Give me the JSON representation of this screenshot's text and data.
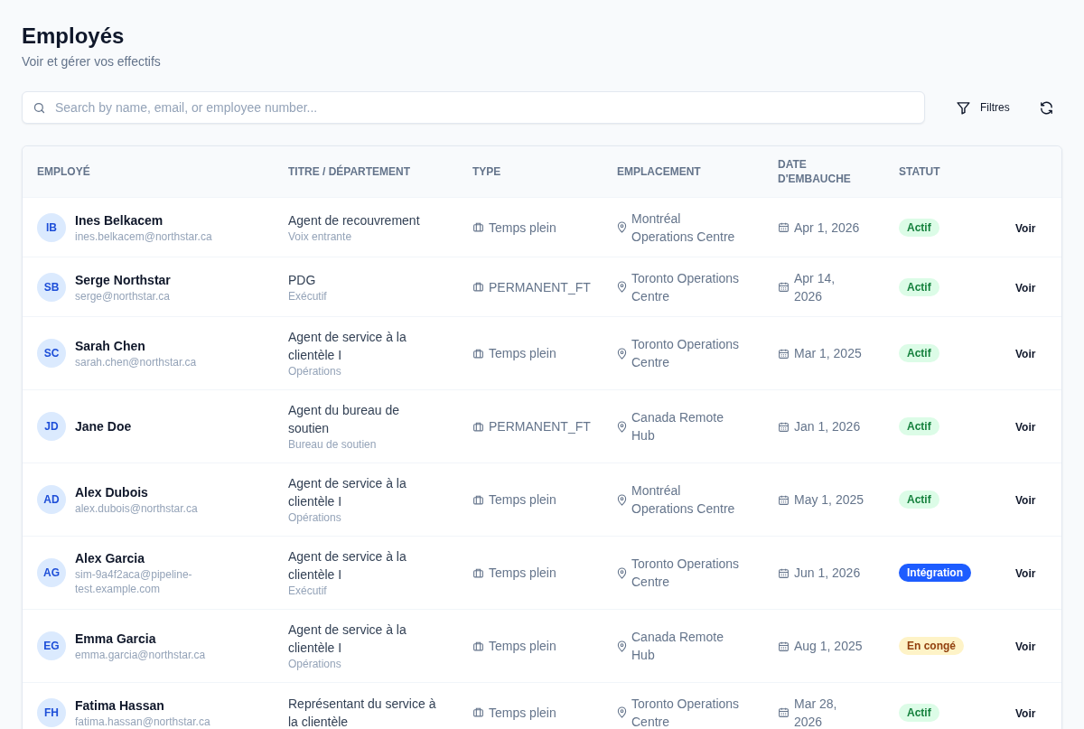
{
  "page": {
    "title": "Employés",
    "subtitle": "Voir et gérer vos effectifs"
  },
  "toolbar": {
    "search_placeholder": "Search by name, email, or employee number...",
    "filter_label": "Filtres"
  },
  "table": {
    "columns": [
      "EMPLOYÉ",
      "TITRE / DÉPARTEMENT",
      "TYPE",
      "EMPLACEMENT",
      "DATE D'EMBAUCHE",
      "STATUT"
    ],
    "rows": [
      {
        "initials": "IB",
        "name": "Ines Belkacem",
        "email": "ines.belkacem@northstar.ca",
        "title": "Agent de recouvrement",
        "department": "Voix entrante",
        "type": "Temps plein",
        "location": "Montréal Operations Centre",
        "hire_date": "Apr 1, 2026",
        "status": {
          "label": "Actif",
          "kind": "active"
        },
        "action": "Voir"
      },
      {
        "initials": "SB",
        "name": "Serge Northstar",
        "email": "serge@northstar.ca",
        "title": "PDG",
        "department": "Exécutif",
        "type": "PERMANENT_FT",
        "location": "Toronto Operations Centre",
        "hire_date": "Apr 14, 2026",
        "status": {
          "label": "Actif",
          "kind": "active"
        },
        "action": "Voir"
      },
      {
        "initials": "SC",
        "name": "Sarah Chen",
        "email": "sarah.chen@northstar.ca",
        "title": "Agent de service à la clientèle I",
        "department": "Opérations",
        "type": "Temps plein",
        "location": "Toronto Operations Centre",
        "hire_date": "Mar 1, 2025",
        "status": {
          "label": "Actif",
          "kind": "active"
        },
        "action": "Voir"
      },
      {
        "initials": "JD",
        "name": "Jane Doe",
        "title": "Agent du bureau de soutien",
        "department": "Bureau de soutien",
        "type": "PERMANENT_FT",
        "location": "Canada Remote Hub",
        "hire_date": "Jan 1, 2026",
        "status": {
          "label": "Actif",
          "kind": "active"
        },
        "action": "Voir"
      },
      {
        "initials": "AD",
        "name": "Alex Dubois",
        "email": "alex.dubois@northstar.ca",
        "title": "Agent de service à la clientèle I",
        "department": "Opérations",
        "type": "Temps plein",
        "location": "Montréal Operations Centre",
        "hire_date": "May 1, 2025",
        "status": {
          "label": "Actif",
          "kind": "active"
        },
        "action": "Voir"
      },
      {
        "initials": "AG",
        "name": "Alex Garcia",
        "email": "sim-9a4f2aca@pipeline-test.example.com",
        "title": "Agent de service à la clientèle I",
        "department": "Exécutif",
        "type": "Temps plein",
        "location": "Toronto Operations Centre",
        "hire_date": "Jun 1, 2026",
        "status": {
          "label": "Intégration",
          "kind": "onboarding"
        },
        "action": "Voir"
      },
      {
        "initials": "EG",
        "name": "Emma Garcia",
        "email": "emma.garcia@northstar.ca",
        "title": "Agent de service à la clientèle I",
        "department": "Opérations",
        "type": "Temps plein",
        "location": "Canada Remote Hub",
        "hire_date": "Aug 1, 2025",
        "status": {
          "label": "En congé",
          "kind": "leave"
        },
        "action": "Voir"
      },
      {
        "initials": "FH",
        "name": "Fatima Hassan",
        "email": "fatima.hassan@northstar.ca",
        "title": "Représentant du service à la clientèle",
        "type": "Temps plein",
        "location": "Toronto Operations Centre",
        "hire_date": "Mar 28, 2026",
        "status": {
          "label": "Actif",
          "kind": "active"
        },
        "action": "Voir"
      }
    ]
  }
}
